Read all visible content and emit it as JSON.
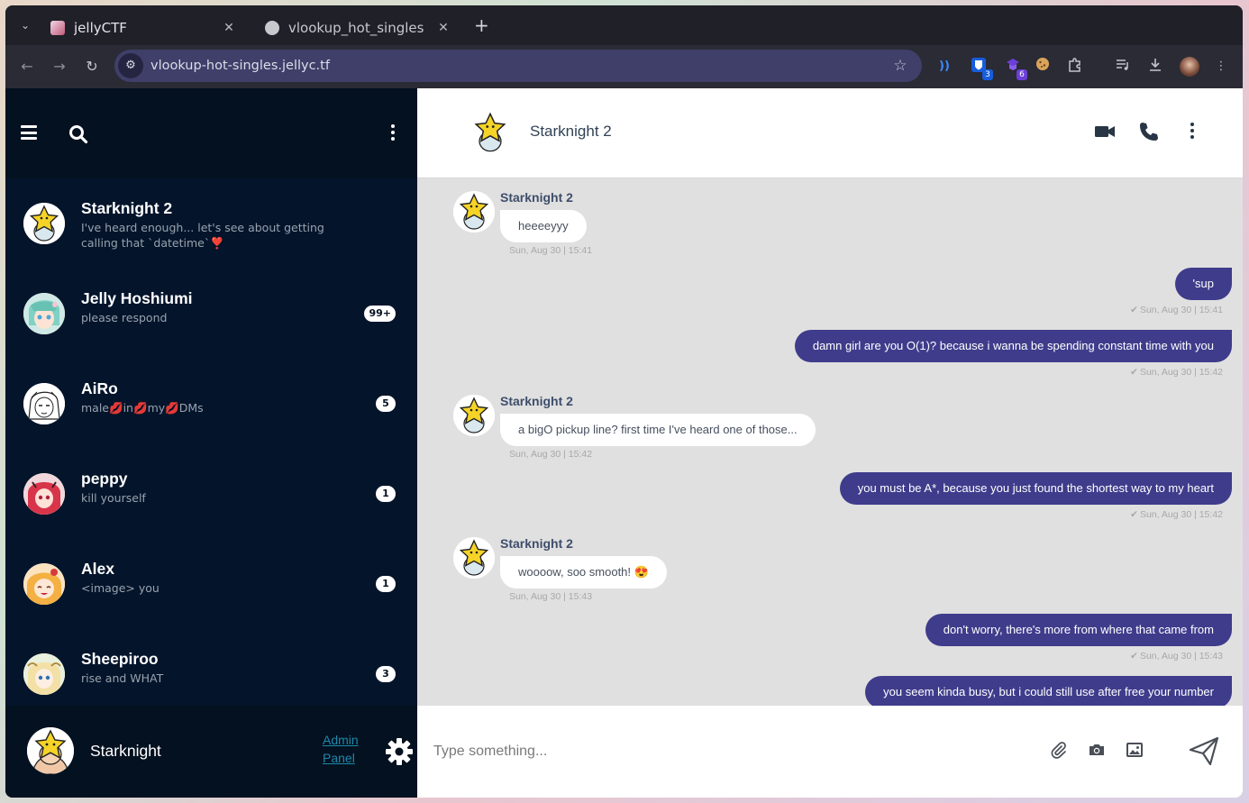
{
  "browser": {
    "tabs": [
      {
        "title": "jellyCTF",
        "active": true
      },
      {
        "title": "vlookup_hot_singles",
        "active": false
      }
    ],
    "url": "vlookup-hot-singles.jellyc.tf",
    "extension_badges": {
      "bitwarden": "3",
      "vpn": "6"
    }
  },
  "colors": {
    "sidebar_bg": "#03142b",
    "outgoing_bubble": "#3f3c8c",
    "incoming_bubble": "#ffffff",
    "link": "#1e88a8"
  },
  "sidebar": {
    "conversations": [
      {
        "name": "Starknight 2",
        "preview": "I've heard enough... let's see about getting calling that `datetime`",
        "preview_emoji": "❣️",
        "badge": ""
      },
      {
        "name": "Jelly Hoshiumi",
        "preview": "please respond",
        "badge": "99+"
      },
      {
        "name": "AiRo",
        "preview_parts": [
          "male",
          "💋",
          "in",
          "💋",
          "my",
          "💋",
          "DMs"
        ],
        "badge": "5"
      },
      {
        "name": "peppy",
        "preview": "kill yourself",
        "badge": "1"
      },
      {
        "name": "Alex",
        "preview": "<image> you",
        "badge": "1"
      },
      {
        "name": "Sheepiroo",
        "preview": "rise and WHAT",
        "badge": "3"
      }
    ],
    "me": {
      "name": "Starknight",
      "admin_link_line1": "Admin",
      "admin_link_line2": "Panel"
    }
  },
  "chat": {
    "contact_name": "Starknight 2",
    "messages": [
      {
        "dir": "in",
        "sender": "Starknight 2",
        "text": "heeeeyyy",
        "time": "Sun, Aug 30 | 15:41"
      },
      {
        "dir": "out",
        "text": "'sup",
        "time": "Sun, Aug 30 | 15:41"
      },
      {
        "dir": "out",
        "text": "damn girl are you O(1)? because i wanna be spending constant time with you",
        "time": "Sun, Aug 30 | 15:42"
      },
      {
        "dir": "in",
        "sender": "Starknight 2",
        "text": "a bigO pickup line? first time I've heard one of those...",
        "time": "Sun, Aug 30 | 15:42"
      },
      {
        "dir": "out",
        "text": "you must be A*, because you just found the shortest way to my heart",
        "time": "Sun, Aug 30 | 15:42"
      },
      {
        "dir": "in",
        "sender": "Starknight 2",
        "text": "woooow, soo smooth! 😍",
        "time": "Sun, Aug 30 | 15:43"
      },
      {
        "dir": "out",
        "text": "don't worry, there's more from where that came from",
        "time": "Sun, Aug 30 | 15:43"
      },
      {
        "dir": "out",
        "text": "you seem kinda busy, but i could still use after free your number",
        "time": ""
      }
    ],
    "composer_placeholder": "Type something..."
  }
}
